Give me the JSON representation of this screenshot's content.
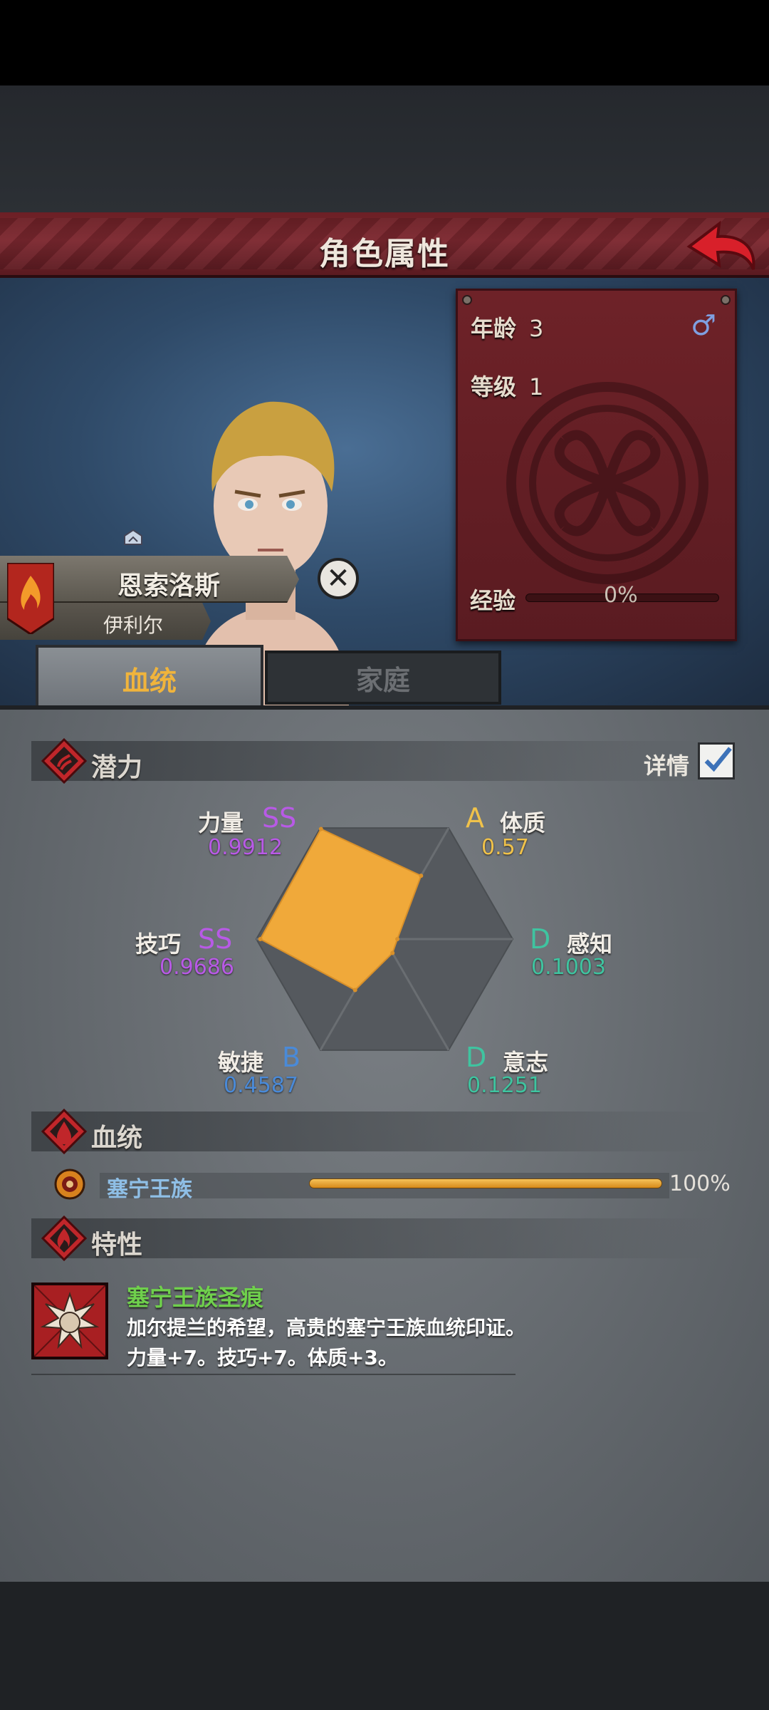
{
  "header": {
    "title": "角色属性"
  },
  "character": {
    "name": "恩索洛斯",
    "subname": "伊利尔",
    "age_label": "年龄",
    "age": "3",
    "level_label": "等级",
    "level": "1",
    "exp_label": "经验",
    "exp_percent": "0%",
    "exp_value": 0,
    "gender_symbol": "♂"
  },
  "tabs": [
    {
      "label": "血统",
      "active": true
    },
    {
      "label": "家庭",
      "active": false
    }
  ],
  "potential": {
    "title": "潜力",
    "detail_label": "详情",
    "detail_checked": true,
    "attributes": [
      {
        "name": "力量",
        "grade": "SS",
        "value": "0.9912",
        "color": "#b85ae6"
      },
      {
        "name": "体质",
        "grade": "A",
        "value": "0.57",
        "color": "#f0c24a"
      },
      {
        "name": "感知",
        "grade": "D",
        "value": "0.1003",
        "color": "#3fc4a0"
      },
      {
        "name": "意志",
        "grade": "D",
        "value": "0.1251",
        "color": "#3fc4a0"
      },
      {
        "name": "敏捷",
        "grade": "B",
        "value": "0.4587",
        "color": "#4a8ad8"
      },
      {
        "name": "技巧",
        "grade": "SS",
        "value": "0.9686",
        "color": "#b85ae6"
      }
    ]
  },
  "bloodline": {
    "title": "血统",
    "name": "塞宁王族",
    "percent": "100%",
    "fill": 1.0
  },
  "traits": {
    "title": "特性",
    "items": [
      {
        "name": "塞宁王族圣痕",
        "description": "加尔提兰的希望，高贵的塞宁王族血统印证。",
        "effect": "力量+7。技巧+7。体质+3。"
      }
    ]
  },
  "colors": {
    "accent_red": "#6e2228",
    "radar_fill": "#f0a93a",
    "tab_active_text": "#f0b43c"
  }
}
